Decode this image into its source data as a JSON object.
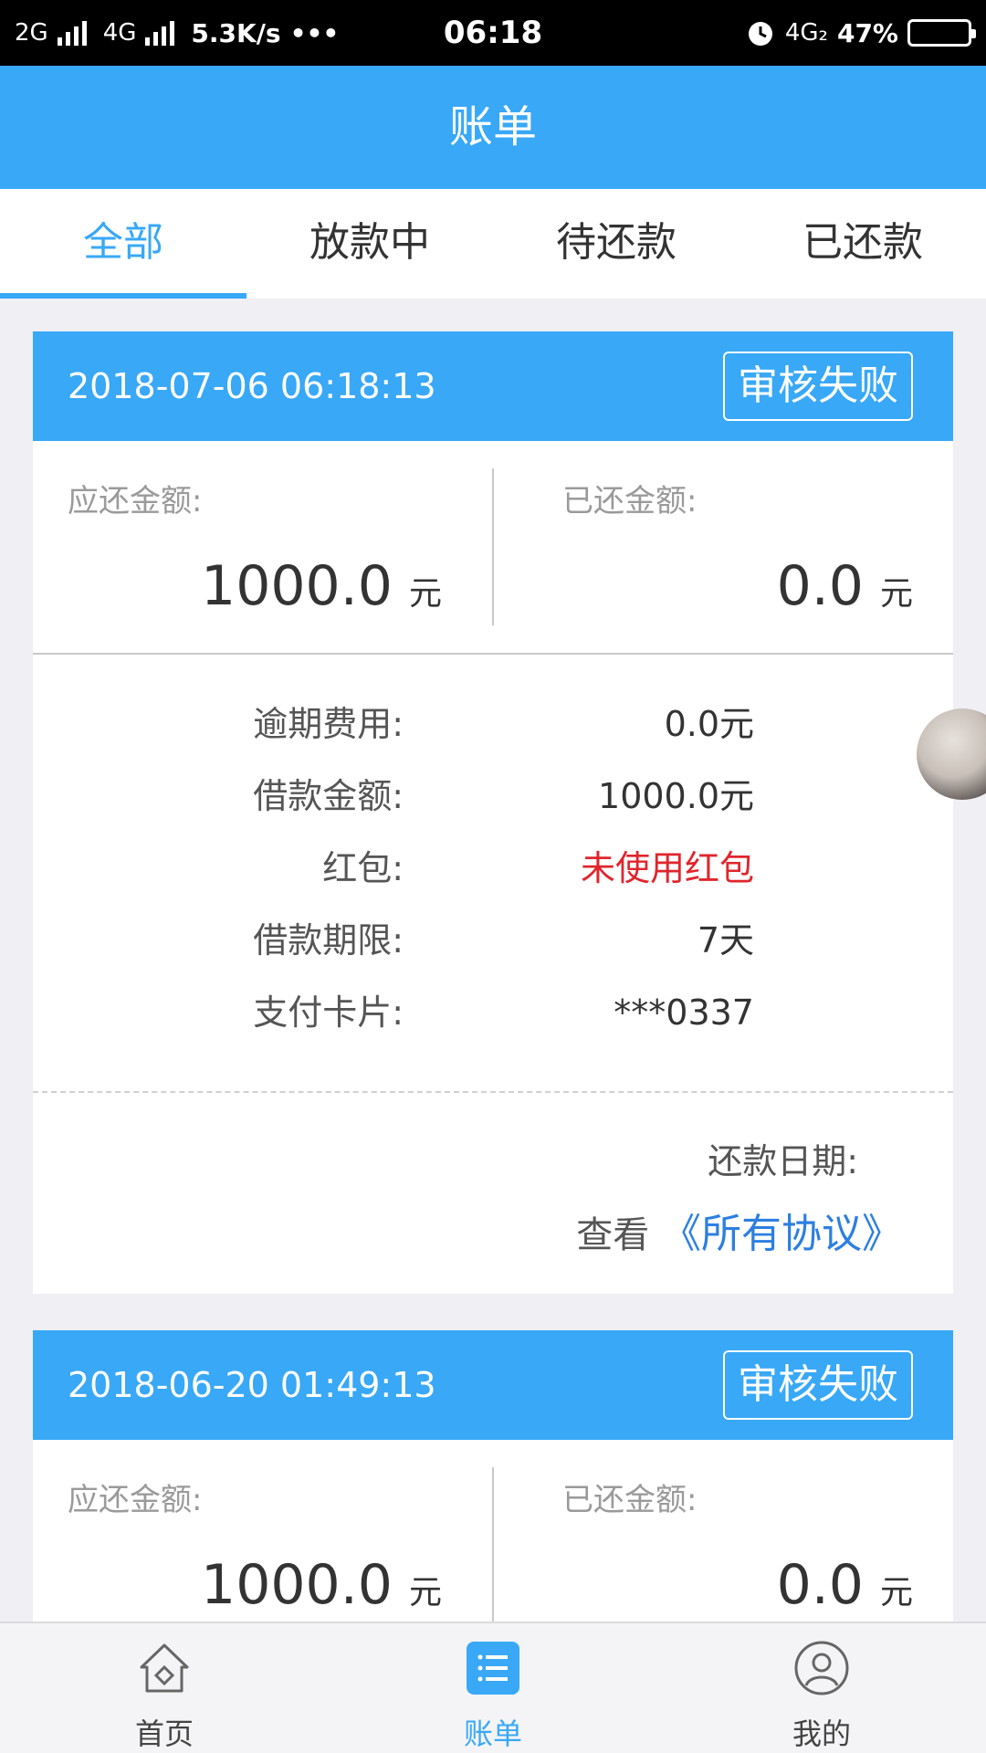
{
  "status_bar": {
    "net1": "2G",
    "net2": "4G",
    "speed": "5.3K/s",
    "more": "•••",
    "time": "06:18",
    "net3": "4G₂",
    "battery": "47%",
    "battery_level": 0.47
  },
  "header": {
    "title": "账单"
  },
  "tabs": [
    {
      "label": "全部",
      "active": true
    },
    {
      "label": "放款中",
      "active": false
    },
    {
      "label": "待还款",
      "active": false
    },
    {
      "label": "已还款",
      "active": false
    }
  ],
  "bills": [
    {
      "date": "2018-07-06 06:18:13",
      "status": "审核失败",
      "due_label": "应还金额:",
      "due_amount": "1000.0",
      "paid_label": "已还金额:",
      "paid_amount": "0.0",
      "unit": "元",
      "details": [
        {
          "label": "逾期费用:",
          "value": "0.0元"
        },
        {
          "label": "借款金额:",
          "value": "1000.0元"
        },
        {
          "label": "红包:",
          "value": "未使用红包"
        },
        {
          "label": "借款期限:",
          "value": "7天"
        },
        {
          "label": "支付卡片:",
          "value": "***0337"
        }
      ],
      "repay_date_label": "还款日期:",
      "agreement_prefix": "查看",
      "agreement_link": "《所有协议》"
    },
    {
      "date": "2018-06-20 01:49:13",
      "status": "审核失败",
      "due_label": "应还金额:",
      "due_amount": "1000.0",
      "paid_label": "已还金额:",
      "paid_amount": "0.0",
      "unit": "元"
    }
  ],
  "bottom_nav": [
    {
      "label": "首页",
      "icon": "home-icon"
    },
    {
      "label": "账单",
      "icon": "bill-list-icon",
      "active": true
    },
    {
      "label": "我的",
      "icon": "profile-icon"
    }
  ],
  "colors": {
    "brand": "#38a8f7",
    "red": "#e0252d",
    "link": "#2d7fe0"
  }
}
